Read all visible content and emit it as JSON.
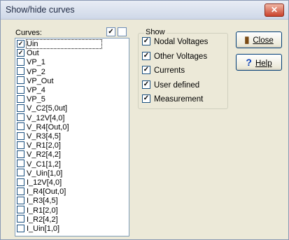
{
  "window": {
    "title": "Show/hide curves",
    "close_symbol": "✕"
  },
  "curves": {
    "label": "Curves:",
    "check_all_symbol": "✓",
    "items": [
      {
        "label": "Uin",
        "checked": true,
        "focused": true
      },
      {
        "label": "Out",
        "checked": true
      },
      {
        "label": "VP_1",
        "checked": false
      },
      {
        "label": "VP_2",
        "checked": false
      },
      {
        "label": "VP_Out",
        "checked": false
      },
      {
        "label": "VP_4",
        "checked": false
      },
      {
        "label": "VP_5",
        "checked": false
      },
      {
        "label": "V_C2[5,0ut]",
        "checked": false
      },
      {
        "label": "V_12V[4,0]",
        "checked": false
      },
      {
        "label": "V_R4[Out,0]",
        "checked": false
      },
      {
        "label": "V_R3[4,5]",
        "checked": false
      },
      {
        "label": "V_R1[2,0]",
        "checked": false
      },
      {
        "label": "V_R2[4,2]",
        "checked": false
      },
      {
        "label": "V_C1[1,2]",
        "checked": false
      },
      {
        "label": "V_Uin[1,0]",
        "checked": false
      },
      {
        "label": "I_12V[4,0]",
        "checked": false
      },
      {
        "label": "I_R4[Out,0]",
        "checked": false
      },
      {
        "label": "I_R3[4,5]",
        "checked": false
      },
      {
        "label": "I_R1[2,0]",
        "checked": false
      },
      {
        "label": "I_R2[4,2]",
        "checked": false
      },
      {
        "label": "I_Uin[1,0]",
        "checked": false
      }
    ]
  },
  "show": {
    "label": "Show",
    "items": [
      {
        "label": "Nodal Voltages",
        "checked": true
      },
      {
        "label": "Other Voltages",
        "checked": true
      },
      {
        "label": "Currents",
        "checked": true
      },
      {
        "label": "User defined",
        "checked": true
      },
      {
        "label": "Measurement",
        "checked": true
      }
    ]
  },
  "buttons": {
    "close": {
      "label": "Close",
      "icon": "door-icon"
    },
    "help": {
      "label": "Help",
      "icon": "help-icon"
    }
  },
  "check_mark": "✓"
}
